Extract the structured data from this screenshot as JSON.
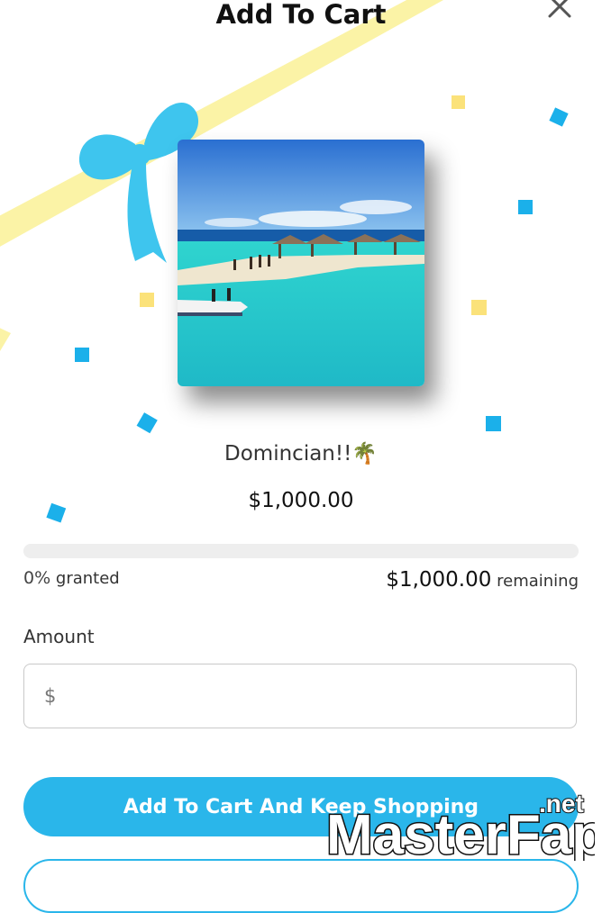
{
  "header": {
    "title": "Add To Cart",
    "close_icon": "close-icon"
  },
  "item": {
    "name": "Domincian!!🌴",
    "price": "$1,000.00",
    "image": "beach-photo"
  },
  "progress": {
    "granted_percent_label": "0%",
    "granted_suffix": "granted",
    "fraction_granted": 0,
    "remaining_amount": "$1,000.00",
    "remaining_suffix": "remaining"
  },
  "amount": {
    "label": "Amount",
    "currency_symbol": "$",
    "value": "",
    "placeholder": ""
  },
  "buttons": {
    "primary_label": "Add To Cart And Keep Shopping"
  },
  "watermark": {
    "text_main": "MasterFap",
    "text_small": ".net"
  },
  "colors": {
    "accent": "#2ab6ea",
    "ribbon": "#fbf3a6",
    "bow": "#3ec5ee",
    "confetti_yellow": "#fbe27a",
    "confetti_blue": "#1bb0ea"
  }
}
